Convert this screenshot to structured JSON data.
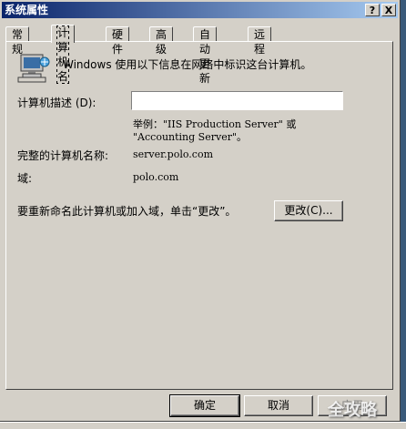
{
  "window": {
    "title": "系统属性",
    "help_btn": "?",
    "close_btn": "X"
  },
  "tabs": [
    {
      "label": "常规"
    },
    {
      "label": "计算机名"
    },
    {
      "label": "硬件"
    },
    {
      "label": "高级"
    },
    {
      "label": "自动更新"
    },
    {
      "label": "远程"
    }
  ],
  "panel": {
    "intro": "Windows 使用以下信息在网络中标识这台计算机。",
    "description_label": "计算机描述 (D):",
    "description_value": "",
    "example_line1": "举例：\"IIS Production Server\" 或",
    "example_line2": "\"Accounting Server\"。",
    "full_name_label": "完整的计算机名称:",
    "full_name_value": "server.polo.com",
    "domain_label": "域:",
    "domain_value": "polo.com",
    "rename_text": "要重新命名此计算机或加入域，单击“更改”。",
    "change_button": "更改(C)..."
  },
  "footer": {
    "ok": "确定",
    "cancel": "取消",
    "apply": "应用"
  },
  "watermark": "全攻略",
  "colors": {
    "dialog_bg": "#d4d0c8",
    "titlebar_start": "#0a246a",
    "titlebar_end": "#a6caf0"
  }
}
